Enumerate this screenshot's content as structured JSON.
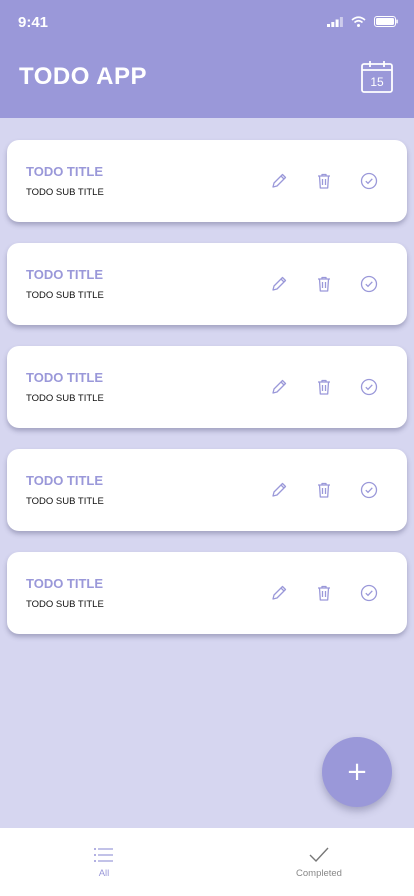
{
  "status_bar": {
    "time": "9:41"
  },
  "header": {
    "title": "TODO APP",
    "calendar_day": "15"
  },
  "todos": [
    {
      "title": "TODO TITLE",
      "subtitle": "TODO SUB TITLE"
    },
    {
      "title": "TODO TITLE",
      "subtitle": "TODO SUB TITLE"
    },
    {
      "title": "TODO TITLE",
      "subtitle": "TODO SUB TITLE"
    },
    {
      "title": "TODO TITLE",
      "subtitle": "TODO SUB TITLE"
    },
    {
      "title": "TODO TITLE",
      "subtitle": "TODO SUB TITLE"
    }
  ],
  "fab": {
    "icon": "plus-icon",
    "label": "+"
  },
  "bottom_nav": {
    "tabs": [
      {
        "label": "All",
        "icon": "list-icon",
        "active": true
      },
      {
        "label": "Completed",
        "icon": "check-icon",
        "active": false
      }
    ]
  },
  "colors": {
    "accent": "#9a98d9",
    "background": "#d6d6f0",
    "card": "#ffffff",
    "subtitle_text": "#111111"
  }
}
